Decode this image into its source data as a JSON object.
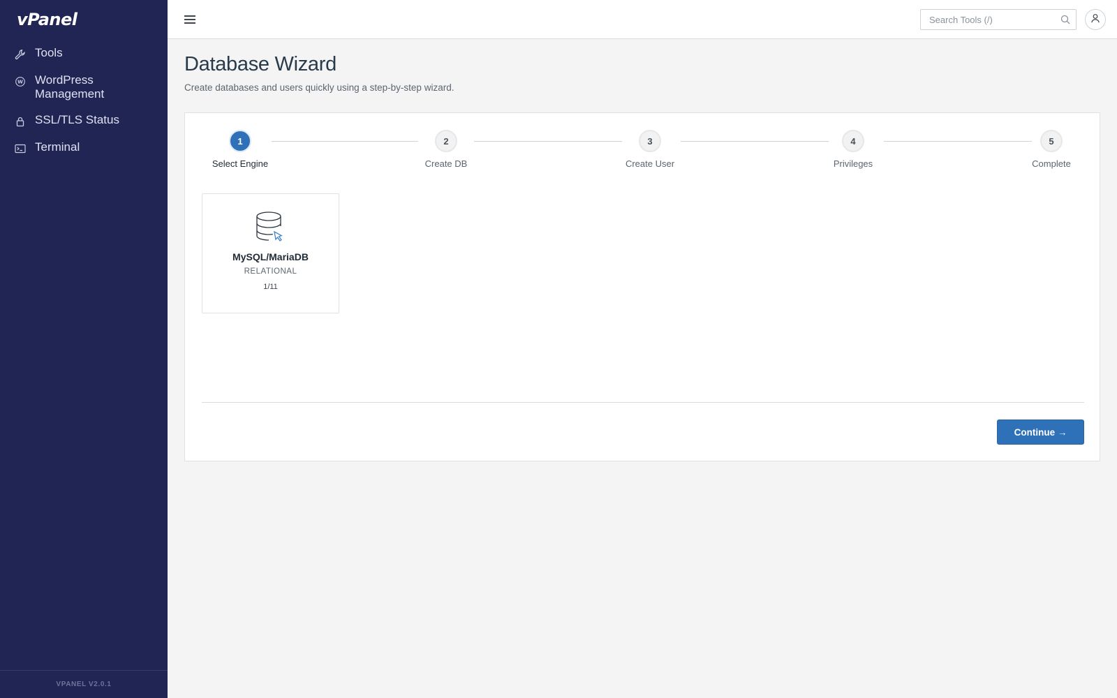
{
  "app": {
    "logo_text": "vPanel",
    "version": "VPANEL V2.0.1"
  },
  "sidebar": {
    "items": [
      {
        "label": "Tools",
        "icon": "wrench-icon"
      },
      {
        "label": "WordPress Management",
        "icon": "wordpress-icon"
      },
      {
        "label": "SSL/TLS Status",
        "icon": "lock-icon"
      },
      {
        "label": "Terminal",
        "icon": "terminal-icon"
      }
    ]
  },
  "topbar": {
    "menu_icon": "hamburger-icon",
    "search_placeholder": "Search Tools (/)",
    "search_icon": "search-icon",
    "user_icon": "user-icon"
  },
  "page": {
    "title": "Database Wizard",
    "subtitle": "Create databases and users quickly using a step-by-step wizard."
  },
  "wizard": {
    "active_step": 1,
    "steps": [
      {
        "number": "1",
        "label": "Select Engine"
      },
      {
        "number": "2",
        "label": "Create DB"
      },
      {
        "number": "3",
        "label": "Create User"
      },
      {
        "number": "4",
        "label": "Privileges"
      },
      {
        "number": "5",
        "label": "Complete"
      }
    ]
  },
  "engines": [
    {
      "name": "MySQL/MariaDB",
      "type": "RELATIONAL",
      "count": "1/11",
      "icon": "database-icon"
    }
  ],
  "actions": {
    "continue_label": "Continue →"
  },
  "colors": {
    "sidebar_bg": "#212553",
    "primary": "#2f71b8",
    "page_bg": "#f4f4f4"
  }
}
